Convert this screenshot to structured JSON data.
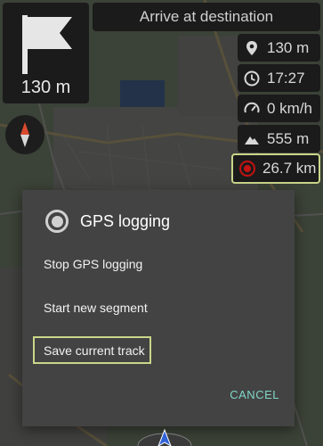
{
  "turn_box": {
    "icon": "flag-icon",
    "distance": "130 m"
  },
  "instruction": {
    "text": "Arrive at destination"
  },
  "compass": {
    "icon": "compass-icon"
  },
  "widgets": {
    "distance": {
      "icon": "location-pin-icon",
      "value": "130 m"
    },
    "time": {
      "icon": "clock-icon",
      "value": "17:27"
    },
    "speed": {
      "icon": "speedometer-icon",
      "value": "0 km/h"
    },
    "altitude": {
      "icon": "mountain-icon",
      "value": "555 m"
    },
    "track": {
      "icon": "record-icon",
      "value": "26.7 km",
      "color": "#c41212"
    }
  },
  "dialog": {
    "icon": "gps-radio-icon",
    "title": "GPS logging",
    "items": [
      {
        "label": "Stop GPS logging"
      },
      {
        "label": "Start new segment"
      },
      {
        "label": "Save current track"
      }
    ],
    "cancel_label": "CANCEL",
    "accent_color": "#7fd6c8",
    "highlight_color": "#c9d68a"
  }
}
